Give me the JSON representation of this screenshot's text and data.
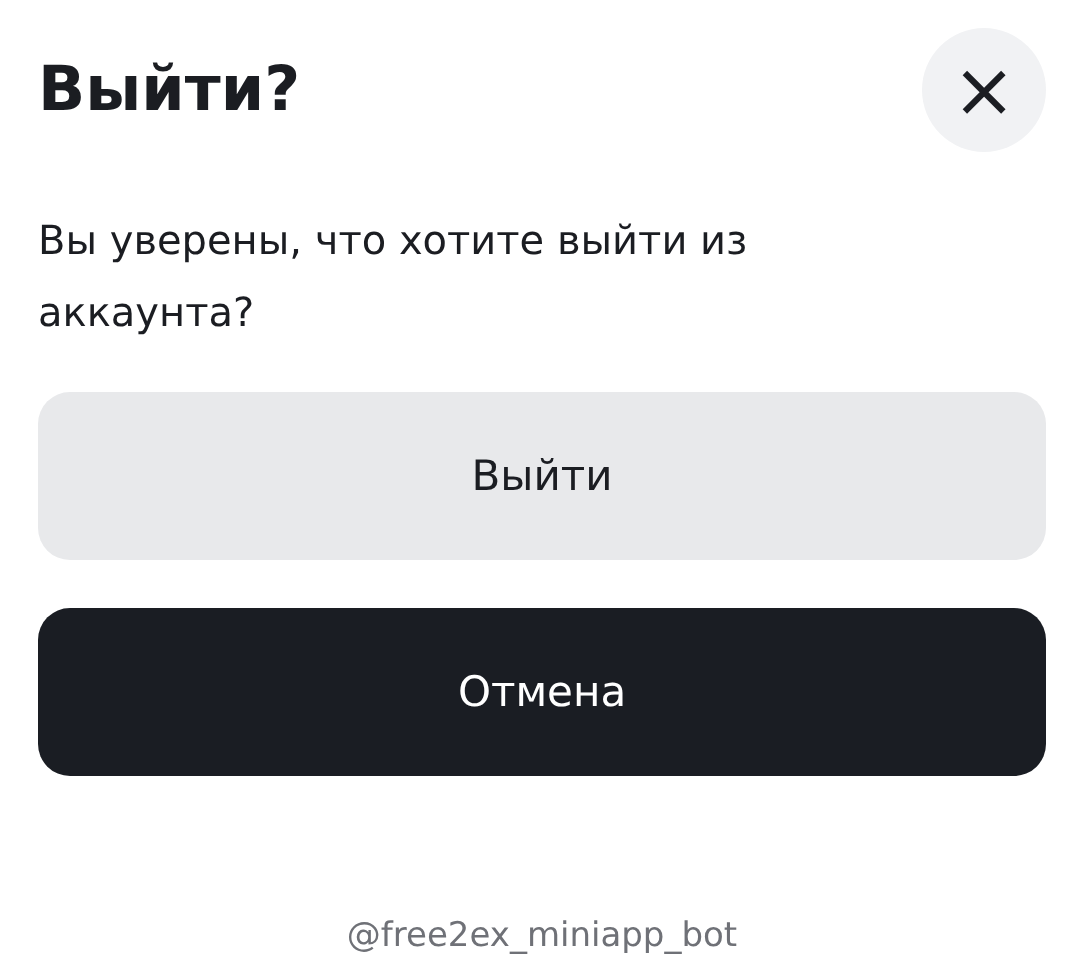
{
  "dialog": {
    "title": "Выйти?",
    "close": "×",
    "message": "Вы уверены, что хотите выйти из аккаунта?",
    "buttons": [
      {
        "label": "Выйти",
        "kind": "secondary"
      },
      {
        "label": "Отмена",
        "kind": "primary"
      }
    ]
  },
  "footer": "@free2ex_miniapp_bot"
}
